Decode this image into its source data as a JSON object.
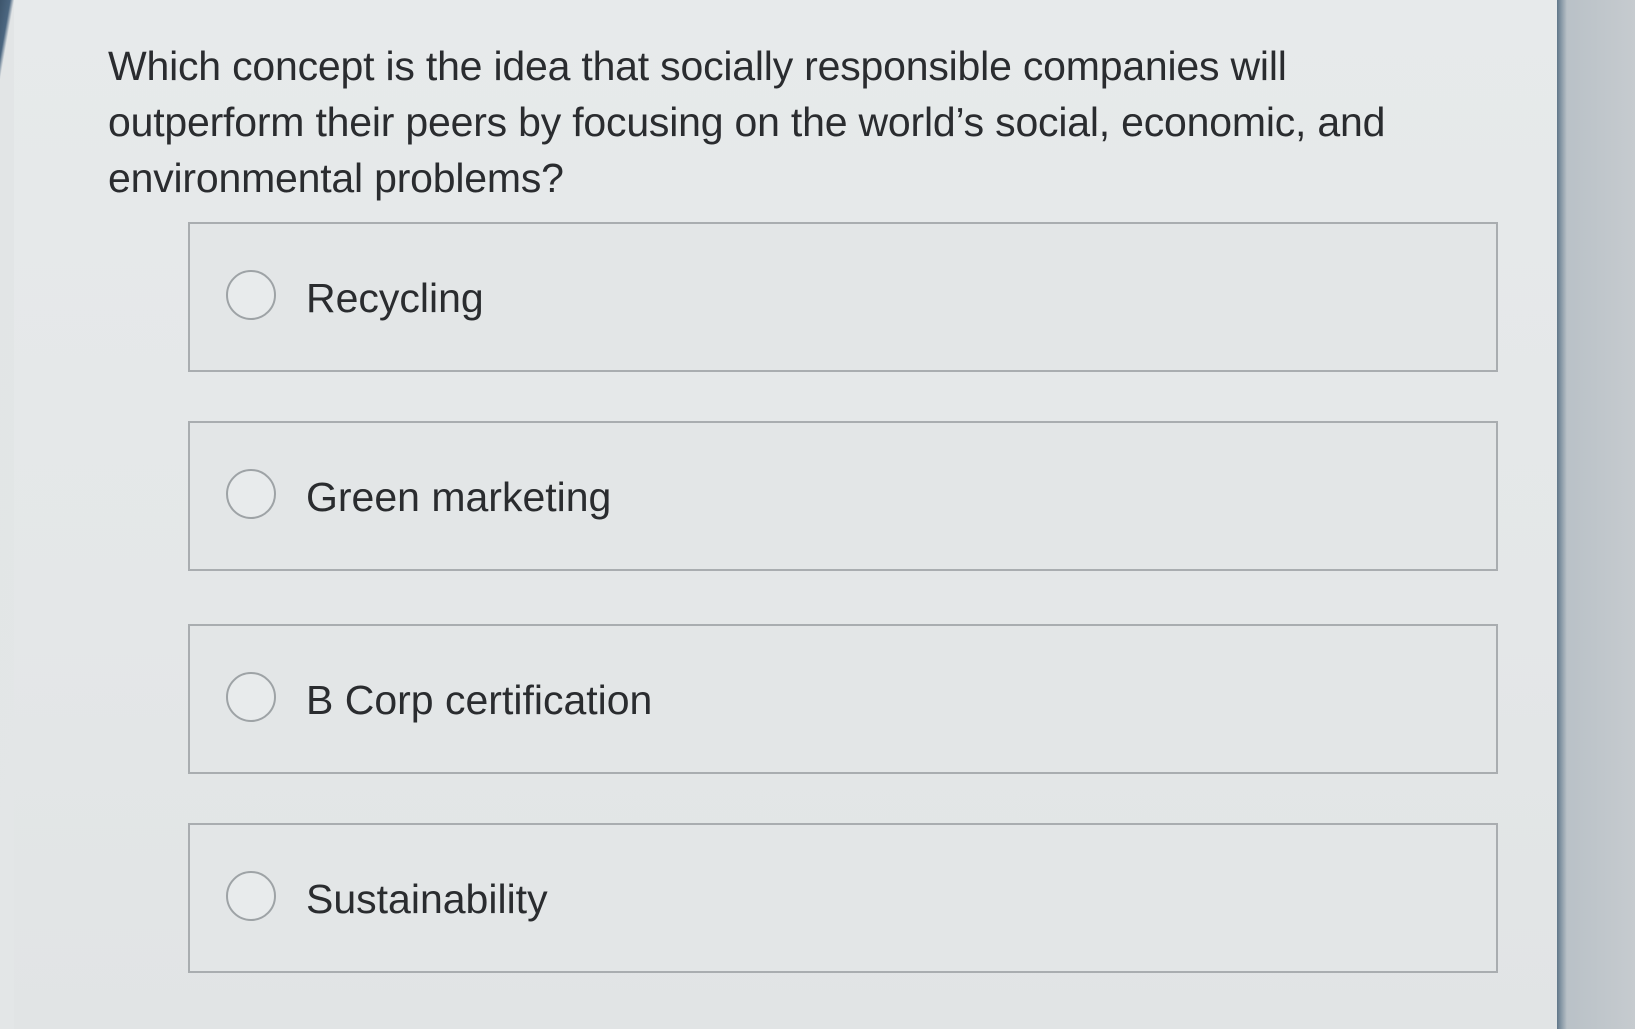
{
  "question": {
    "text": "Which concept is the idea that socially responsible companies will outperform their peers by focusing on the world’s social, economic, and environmental problems?"
  },
  "options": [
    {
      "label": "Recycling",
      "selected": false
    },
    {
      "label": "Green marketing",
      "selected": false
    },
    {
      "label": "B Corp certification",
      "selected": false
    },
    {
      "label": "Sustainability",
      "selected": false
    }
  ],
  "colors": {
    "text": "#2a2c2f",
    "border": "#a9adb0",
    "background": "#e6e9ea",
    "frame": "#4b6680"
  }
}
